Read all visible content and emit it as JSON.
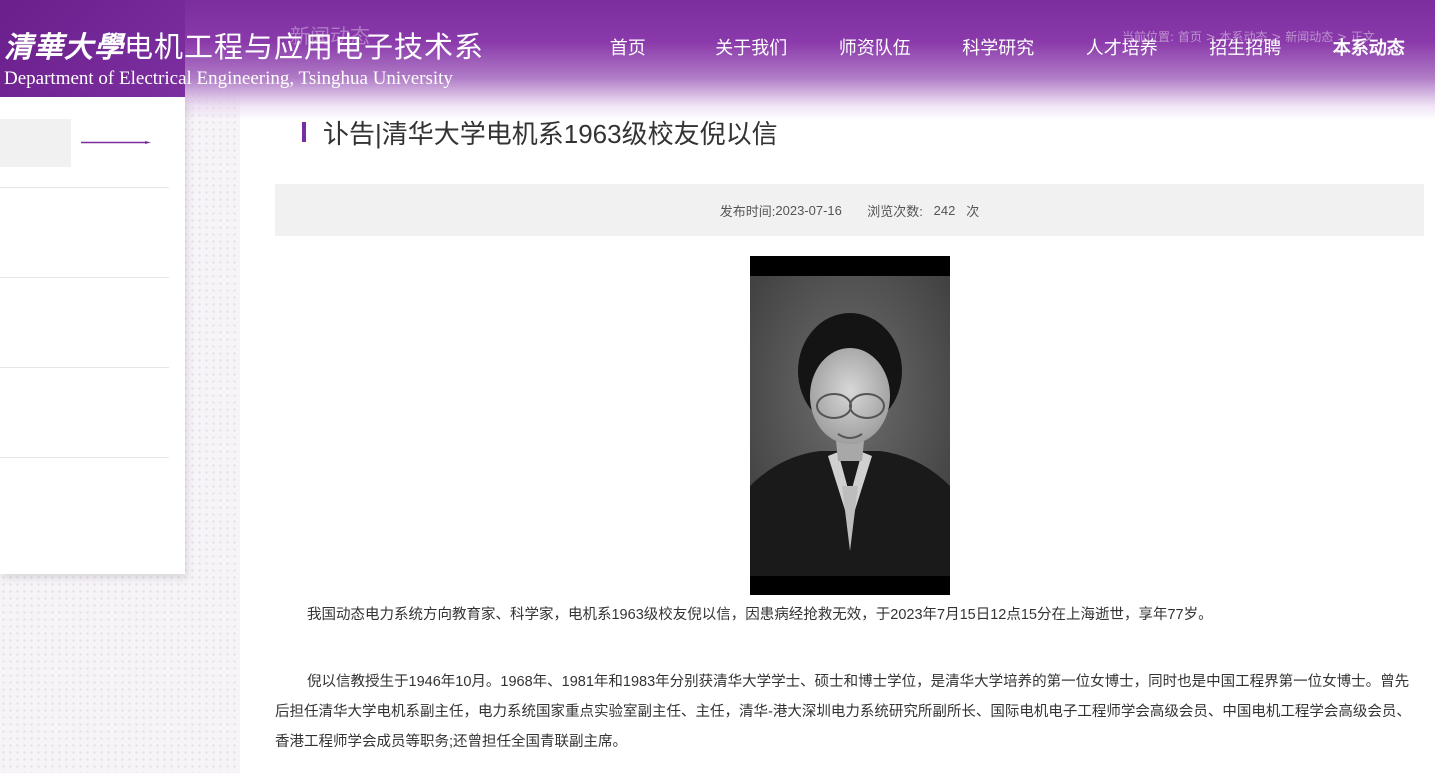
{
  "header": {
    "logo_script": "清華大學",
    "logo_cn": "电机工程与应用电子技术系",
    "logo_en": "Department of Electrical Engineering, Tsinghua University",
    "section_ghost": "新闻动态",
    "breadcrumb": "当前位置: 首页 > 本系动态 > 新闻动态 > 正文"
  },
  "nav": {
    "items": [
      "首页",
      "关于我们",
      "师资队伍",
      "科学研究",
      "人才培养",
      "招生招聘",
      "本系动态"
    ],
    "active_index": 6
  },
  "article": {
    "title": "讣告|清华大学电机系1963级校友倪以信",
    "publish_label": "发布时间:",
    "publish_date": "2023-07-16",
    "views_label": "浏览次数:",
    "views_count": "242",
    "views_unit": "次",
    "para1": "我国动态电力系统方向教育家、科学家，电机系1963级校友倪以信，因患病经抢救无效，于2023年7月15日12点15分在上海逝世，享年77岁。",
    "para2": "倪以信教授生于1946年10月。1968年、1981年和1983年分别获清华大学学士、硕士和博士学位，是清华大学培养的第一位女博士，同时也是中国工程界第一位女博士。曾先后担任清华大学电机系副主任，电力系统国家重点实验室副主任、主任，清华-港大深圳电力系统研究所副所长、国际电机电子工程师学会高级会员、中国电机工程学会高级会员、香港工程师学会成员等职务;还曾担任全国青联副主席。"
  },
  "colors": {
    "brand_purple": "#7b2d9e",
    "meta_bg": "#f1f1f1"
  }
}
